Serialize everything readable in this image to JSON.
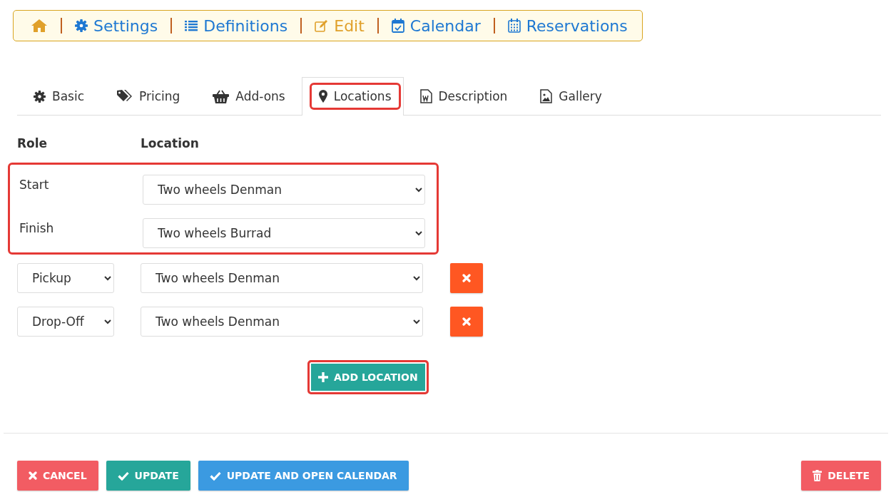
{
  "nav": [
    {
      "kind": "home",
      "color": "#e0a02a"
    },
    {
      "kind": "settings",
      "label": "Settings",
      "color": "#1e78d2"
    },
    {
      "kind": "definitions",
      "label": "Definitions",
      "color": "#1e78d2"
    },
    {
      "kind": "edit",
      "label": "Edit",
      "color": "#e0a02a"
    },
    {
      "kind": "calendar",
      "label": "Calendar",
      "color": "#1e78d2"
    },
    {
      "kind": "reservations",
      "label": "Reservations",
      "color": "#1e78d2"
    }
  ],
  "tabs": [
    {
      "kind": "basic",
      "label": "Basic",
      "selected": false,
      "highlighted": false
    },
    {
      "kind": "pricing",
      "label": "Pricing",
      "selected": false,
      "highlighted": false
    },
    {
      "kind": "addons",
      "label": "Add-ons",
      "selected": false,
      "highlighted": false
    },
    {
      "kind": "locations",
      "label": "Locations",
      "selected": true,
      "highlighted": true
    },
    {
      "kind": "description",
      "label": "Description",
      "selected": false,
      "highlighted": false
    },
    {
      "kind": "gallery",
      "label": "Gallery",
      "selected": false,
      "highlighted": false
    }
  ],
  "locations": {
    "columns": [
      "Role",
      "Location"
    ],
    "fixed_highlighted": true,
    "fixed_rows": [
      {
        "role": "Start",
        "location": "Two wheels Denman"
      },
      {
        "role": "Finish",
        "location": "Two wheels Burrad"
      }
    ],
    "extra_rows": [
      {
        "role": "Pickup",
        "location": "Two wheels Denman"
      },
      {
        "role": "Drop-Off",
        "location": "Two wheels Denman"
      }
    ],
    "add_button": {
      "label": "ADD LOCATION",
      "highlighted": true
    }
  },
  "actions": [
    {
      "kind": "cancel",
      "label": "CANCEL"
    },
    {
      "kind": "update",
      "label": "UPDATE"
    },
    {
      "kind": "update_open",
      "label": "UPDATE AND OPEN CALENDAR"
    },
    {
      "kind": "delete",
      "label": "DELETE"
    }
  ]
}
